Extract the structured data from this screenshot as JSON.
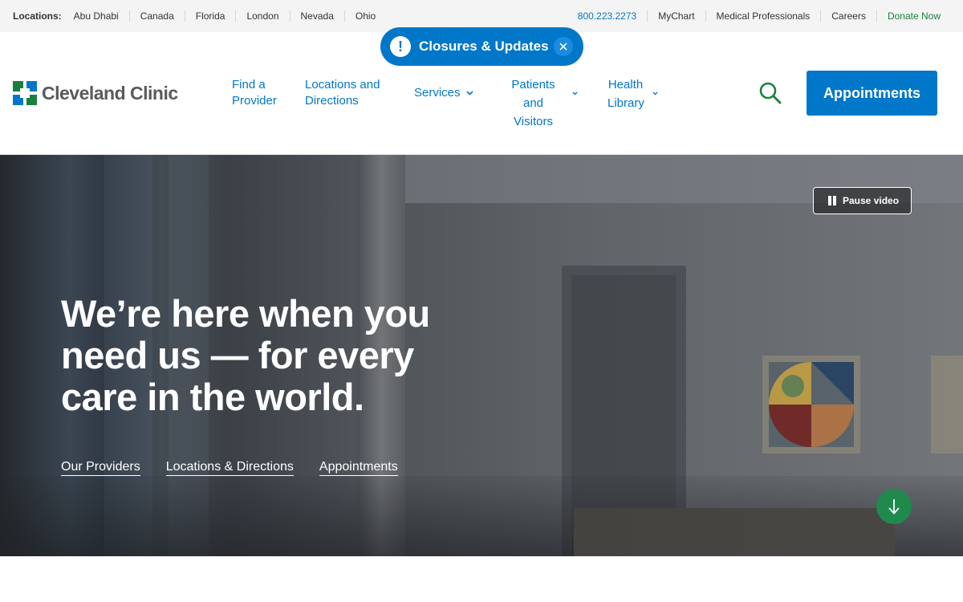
{
  "utility_bar": {
    "locations_label": "Locations:",
    "locations": [
      "Abu Dhabi",
      "Canada",
      "Florida",
      "London",
      "Nevada",
      "Ohio"
    ],
    "phone": "800.223.2273",
    "links": [
      "MyChart",
      "Medical Professionals",
      "Careers"
    ],
    "donate": "Donate Now"
  },
  "alert": {
    "label": "Closures & Updates",
    "icon": "exclamation-icon",
    "close_icon": "close-icon"
  },
  "header": {
    "logo_text": "Cleveland Clinic",
    "nav": {
      "find_provider_1": "Find a",
      "find_provider_2": "Provider",
      "locations_1": "Locations and",
      "locations_2": "Directions",
      "services": "Services",
      "patients_1": "Patients and",
      "patients_2": "Visitors",
      "health_1": "Health",
      "health_2": "Library"
    },
    "appointments_button": "Appointments"
  },
  "hero": {
    "pause_label": "Pause video",
    "headline": "We’re here when you need us — for every care in the world.",
    "links": [
      "Our Providers",
      "Locations & Directions",
      "Appointments"
    ]
  },
  "colors": {
    "brand_blue": "#0077c8",
    "brand_green": "#1a7f3e"
  }
}
